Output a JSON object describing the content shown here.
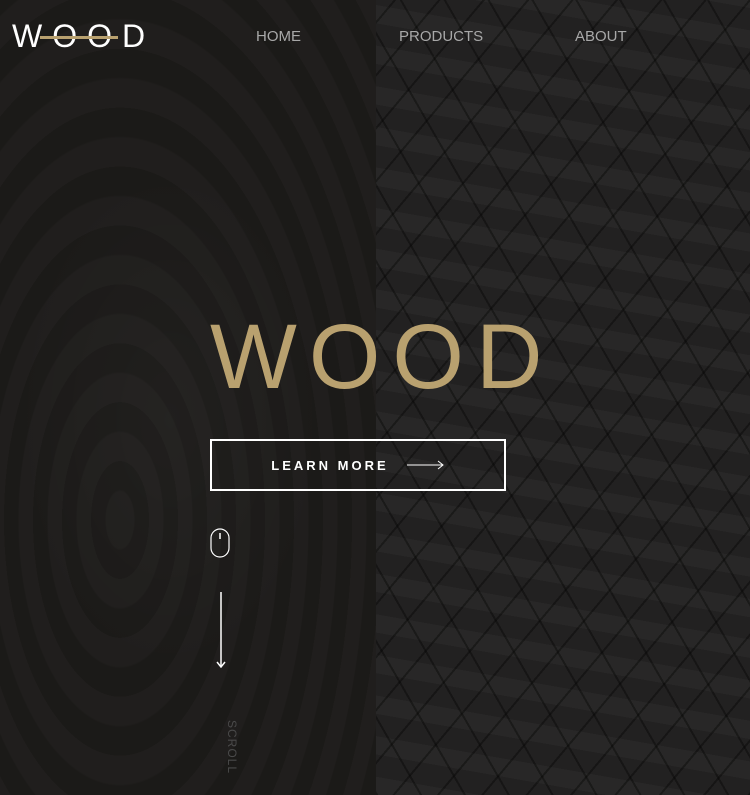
{
  "brand": {
    "logo_text": "WOOD",
    "accent_color": "#b9a16f"
  },
  "nav": {
    "home": "HOME",
    "products": "PRODUCTS",
    "about": "ABOUT"
  },
  "hero": {
    "title": "WOOD",
    "cta_label": "LEARN MORE",
    "scroll_label": "SCROLL"
  },
  "icons": {
    "arrow": "arrow-right-icon",
    "mouse": "mouse-icon",
    "scroll": "arrow-down-icon"
  }
}
